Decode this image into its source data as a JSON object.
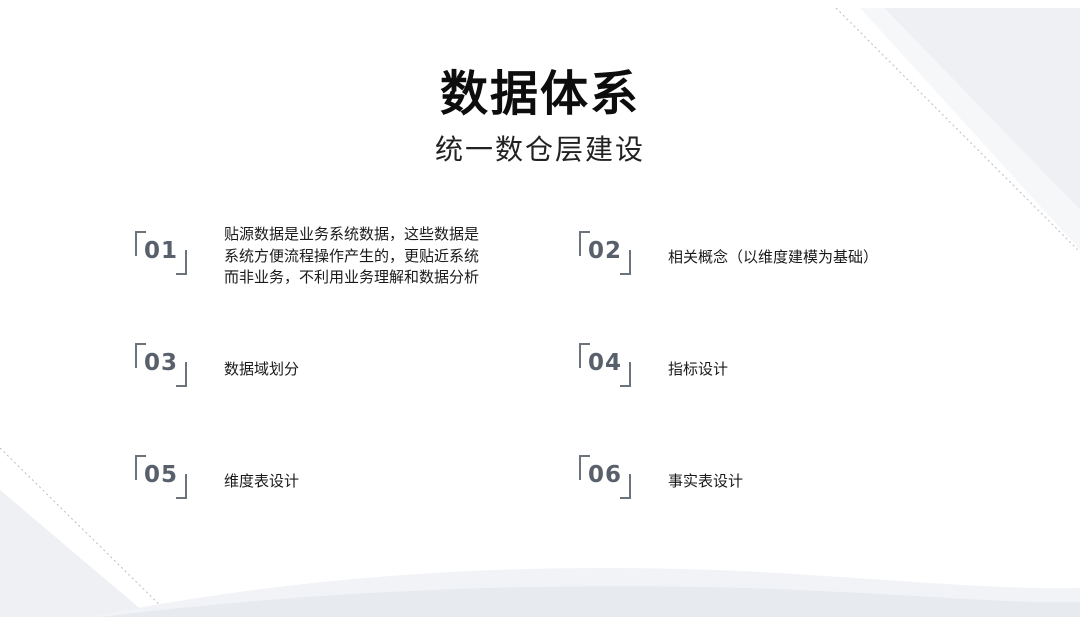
{
  "header": {
    "title": "数据体系",
    "subtitle": "统一数仓层建设"
  },
  "items": [
    {
      "number": "01",
      "text": "贴源数据是业务系统数据，这些数据是系统方便流程操作产生的，更贴近系统而非业务，不利用业务理解和数据分析"
    },
    {
      "number": "02",
      "text": "相关概念（以维度建模为基础）"
    },
    {
      "number": "03",
      "text": "数据域划分"
    },
    {
      "number": "04",
      "text": "指标设计"
    },
    {
      "number": "05",
      "text": "维度表设计"
    },
    {
      "number": "06",
      "text": "事实表设计"
    }
  ],
  "colors": {
    "number": "#58616b",
    "bracket": "#6b737c",
    "decor": "#eef0f3"
  }
}
